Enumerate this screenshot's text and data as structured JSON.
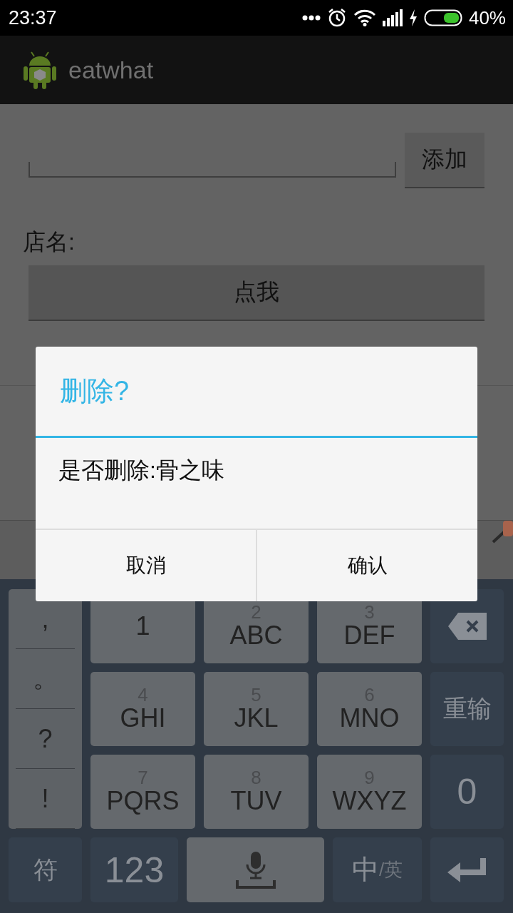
{
  "status_bar": {
    "time": "23:37",
    "battery": "40%"
  },
  "app_bar": {
    "title": "eatwhat"
  },
  "form": {
    "add_button": "添加",
    "store_label": "店名:",
    "click_button": "点我"
  },
  "dialog": {
    "title": "删除?",
    "message": "是否删除:骨之味",
    "buttons": [
      {
        "label": "取消"
      },
      {
        "label": "确认"
      }
    ]
  },
  "keyboard": {
    "symbols": [
      ",",
      "。",
      "?",
      "!"
    ],
    "keys": [
      {
        "kind": "digit",
        "label": "1"
      },
      {
        "kind": "letters",
        "digit": "2",
        "letters": "ABC"
      },
      {
        "kind": "letters",
        "digit": "3",
        "letters": "DEF"
      },
      {
        "kind": "delete"
      },
      {
        "kind": "letters",
        "digit": "4",
        "letters": "GHI"
      },
      {
        "kind": "letters",
        "digit": "5",
        "letters": "JKL"
      },
      {
        "kind": "letters",
        "digit": "6",
        "letters": "MNO"
      },
      {
        "kind": "func",
        "label": "重输"
      },
      {
        "kind": "letters",
        "digit": "7",
        "letters": "PQRS"
      },
      {
        "kind": "letters",
        "digit": "8",
        "letters": "TUV"
      },
      {
        "kind": "letters",
        "digit": "9",
        "letters": "WXYZ"
      },
      {
        "kind": "big",
        "label": "0"
      }
    ],
    "bottom": [
      {
        "kind": "func",
        "label": "符"
      },
      {
        "kind": "big",
        "label": "123"
      },
      {
        "kind": "voice"
      },
      {
        "kind": "lang",
        "main": "中",
        "sub": "/英"
      },
      {
        "kind": "enter"
      }
    ]
  }
}
